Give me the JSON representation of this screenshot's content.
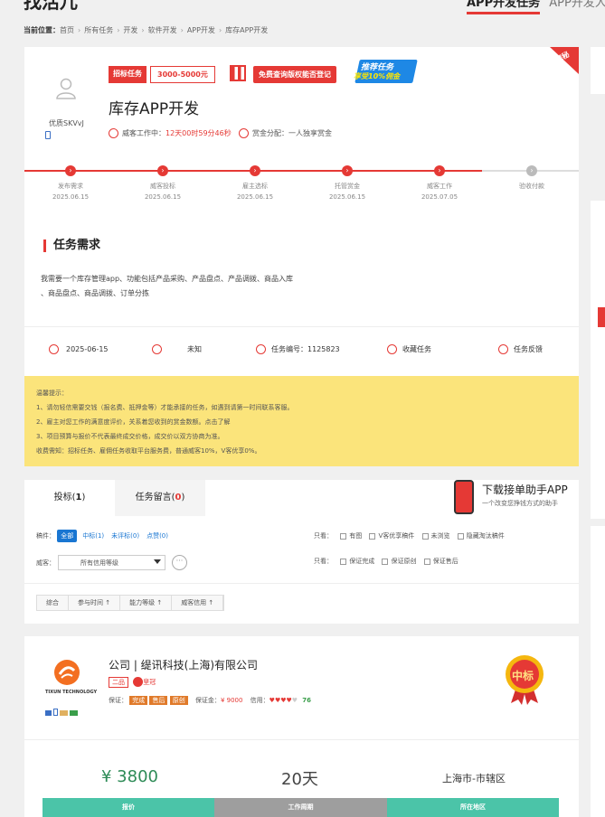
{
  "page": {
    "title": "找活儿",
    "top_tabs": [
      "APP开发任务",
      "APP开发人才"
    ]
  },
  "breadcrumb": {
    "prefix": "当前位置：",
    "items": [
      "首页",
      "所有任务",
      "开发",
      "软件开发",
      "APP开发",
      "库存APP开发"
    ]
  },
  "employer": {
    "username": "优质SKVvJ"
  },
  "task": {
    "mode_tag": "招标任务",
    "budget": "3000-5000元",
    "check_button": "免费查询版权能否登记",
    "promo_line1": "推荐任务",
    "promo_line2": "享受10%佣金",
    "corner_tag": "探秘",
    "title": "库存APP开发",
    "status_label": "威客工作中：",
    "countdown": "12天00时59分46秒",
    "reward_label": "赏金分配：",
    "reward_value": "一人独享赏金"
  },
  "steps": [
    {
      "label": "发布需求",
      "date": "2025.06.15",
      "done": true
    },
    {
      "label": "威客投标",
      "date": "2025.06.15",
      "done": true
    },
    {
      "label": "雇主选标",
      "date": "2025.06.15",
      "done": true
    },
    {
      "label": "托管赏金",
      "date": "2025.06.15",
      "done": true
    },
    {
      "label": "威客工作",
      "date": "2025.07.05",
      "done": true
    },
    {
      "label": "验收付款",
      "date": "",
      "done": false
    }
  ],
  "requirement": {
    "heading": "任务需求",
    "line1": "我需要一个库存管理app、功能包括产品采购、产品盘点、产品调拨、商品入库",
    "line2": "、商品盘点、商品调拨、订单分拣"
  },
  "info_bar": {
    "date": "2025-06-15",
    "location": "未知",
    "task_no_label": "任务编号：",
    "task_no": "1125823",
    "favorite": "收藏任务",
    "feedback": "任务反馈"
  },
  "notice": {
    "title": "温馨提示：",
    "l1": "1、请勿轻信需要交钱（报名费、抵押金等）才能承接的任务，如遇到请第一时间联系客服。",
    "l2": "2、雇主对您工作的满意度评价，关系着您收到的赏金数额。点击了解",
    "l3": "3、项目预算与报价不代表最终成交价格，成交价以双方协商为准。",
    "fee": "收费需知：招标任务、雇佣任务收取平台服务费，普通威客10%，V客优享0%。"
  },
  "bid_tabs": {
    "tab1_label": "投标(",
    "tab1_count": "1",
    "tab2_label": "任务留言(",
    "tab2_count": "0",
    "close": ")"
  },
  "app_download": {
    "title": "下载接单助手APP",
    "subtitle": "一个改变您挣钱方式的助手"
  },
  "filters": {
    "draft_label": "稿件：",
    "all": "全部",
    "won": "中标(1)",
    "unrated": "未评标(0)",
    "eliminated": "点赞(0)",
    "view_label": "只看：",
    "opts1": [
      "有图",
      "V客优享稿件",
      "未浏览",
      "隐藏淘汰稿件"
    ],
    "opts2": [
      "保证完成",
      "保证原创",
      "保证售后"
    ],
    "witkey_label": "威客：",
    "level_select": "所有信用等级",
    "more": "···"
  },
  "sort": [
    "综合",
    "参与时间 ↑",
    "能力等级 ↑",
    "威客信用 ↑"
  ],
  "bid": {
    "company": "公司 | 缇讯科技(上海)有限公司",
    "level": "二品",
    "crown": "皇冠",
    "guarantee_label": "保证：",
    "g1": "完成",
    "g2": "售后",
    "g3": "原创",
    "deposit_label": "保证金：",
    "deposit": "¥ 9000",
    "credit_label": "信用：",
    "credit_score": "76",
    "logo_text": "TIXUN TECHNOLOGY",
    "medal": "中标",
    "price": "¥ 3800",
    "days": "20天",
    "area": "上海市-市辖区",
    "price_label": "报价",
    "days_label": "工作周期",
    "area_label": "所在地区"
  }
}
